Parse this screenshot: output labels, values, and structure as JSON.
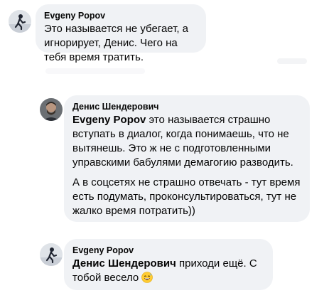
{
  "comments": [
    {
      "author": "Evgeny Popov",
      "text": "Это называется не убегает, а игнорирует, Денис. Чего на тебя время тратить."
    },
    {
      "author": "Денис Шендерович",
      "mention": "Evgeny Popov",
      "text_after_mention": " это называется страшно вступать в диалог, когда понимаешь, что не вытянешь. Это ж не с подготовленными управскими бабулями демагогию разводить.",
      "paragraph2": "А в соцсетях не страшно отвечать - тут время есть подумать, проконсультироваться, тут не жалко время потратить))"
    },
    {
      "author": "Evgeny Popov",
      "mention": "Денис Шендерович",
      "text_after_mention": " приходи ещё. С тобой весело",
      "emoji": "grinning-sweat-emoji"
    }
  ],
  "colors": {
    "bubble": "#f0f2f5",
    "text": "#050505"
  },
  "icons": [
    "avatar-evgeny",
    "avatar-denis",
    "grinning-sweat-emoji"
  ]
}
